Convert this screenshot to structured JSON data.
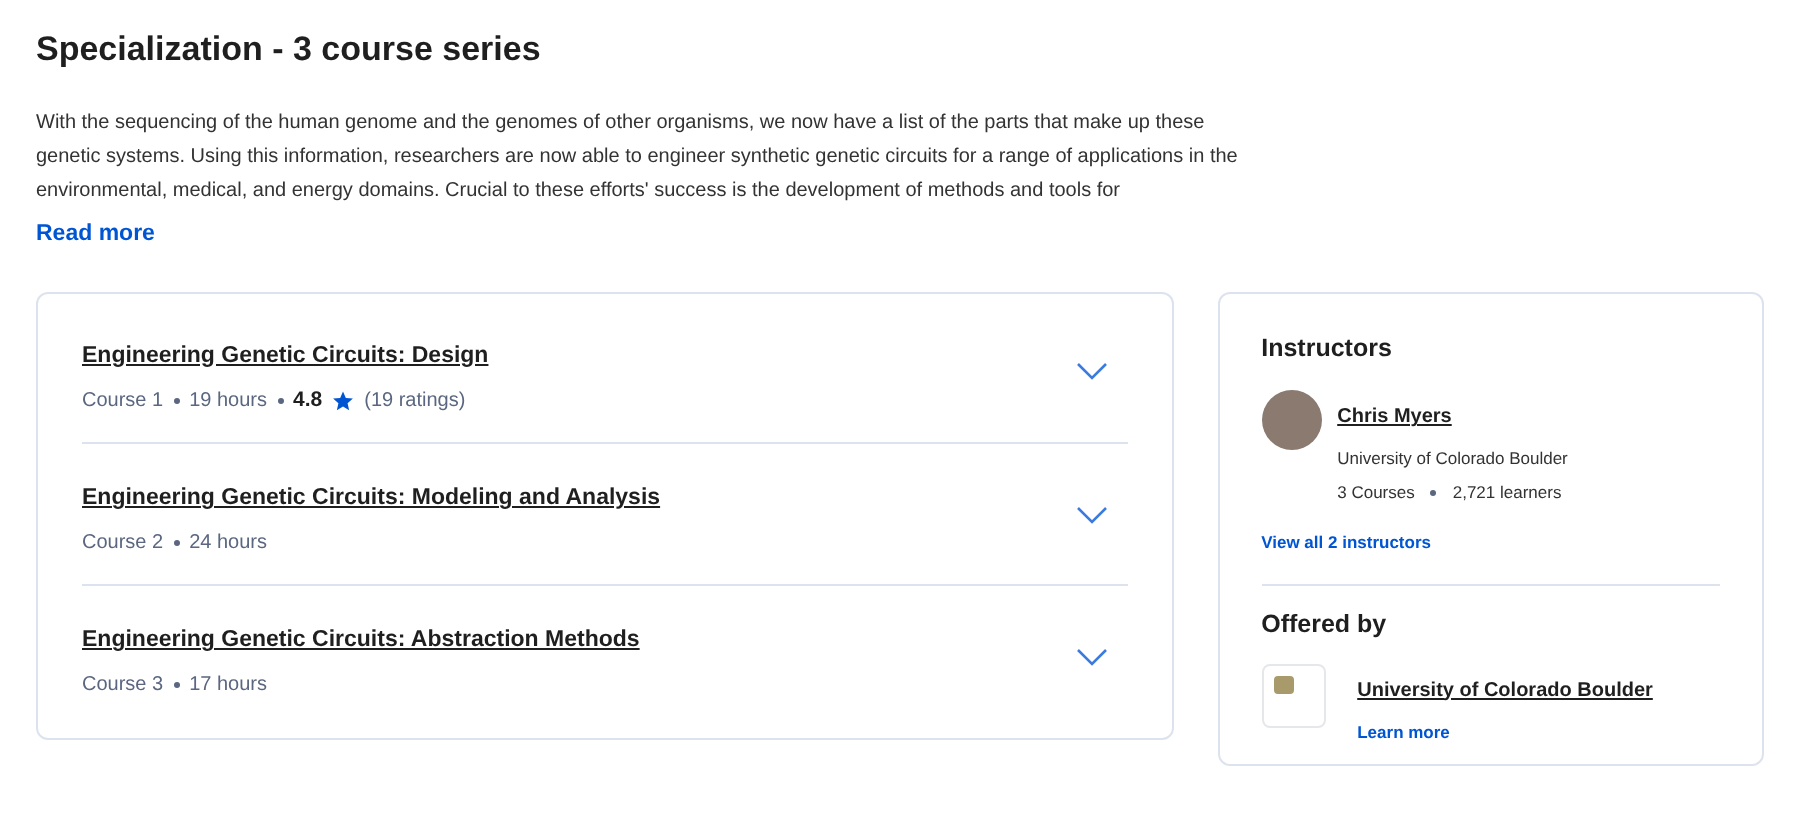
{
  "title": "Specialization - 3 course series",
  "description": "With the sequencing of the human genome and the genomes of other organisms, we now have a list of the parts that make up these genetic systems. Using this information, researchers are now able to engineer synthetic genetic circuits for a range of applications in the environmental, medical, and energy domains. Crucial to these efforts' success is the development of methods and tools for",
  "read_more": "Read more",
  "courses": [
    {
      "title": "Engineering Genetic Circuits: Design",
      "number": "Course 1",
      "duration": "19 hours",
      "rating": "4.8",
      "ratings_count": "(19 ratings)",
      "expanded": false
    },
    {
      "title": "Engineering Genetic Circuits: Modeling and Analysis",
      "number": "Course 2",
      "duration": "24 hours",
      "expanded": false
    },
    {
      "title": "Engineering Genetic Circuits: Abstraction Methods",
      "number": "Course 3",
      "duration": "17 hours",
      "expanded": false
    }
  ],
  "instructors": {
    "heading": "Instructors",
    "items": [
      {
        "name": "Chris Myers",
        "org": "University of Colorado Boulder",
        "courses": "3 Courses",
        "learners": "2,721 learners"
      }
    ],
    "view_all": "View all 2 instructors"
  },
  "offered_by": {
    "heading": "Offered by",
    "name": "University of Colorado Boulder",
    "link": "Learn more"
  }
}
